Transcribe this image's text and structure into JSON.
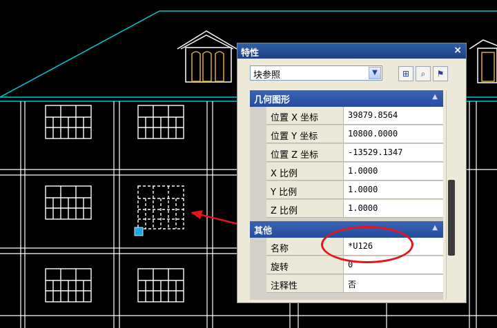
{
  "palette": {
    "title": "特性",
    "close": "×",
    "selection": "块参照",
    "category_geometry": "几何图形",
    "category_other": "其他",
    "collapse": "▲",
    "geometry_rows": [
      {
        "name": "位置 X 坐标",
        "value": "39879.8564"
      },
      {
        "name": "位置 Y 坐标",
        "value": "10800.0000"
      },
      {
        "name": "位置 Z 坐标",
        "value": "-13529.1347"
      },
      {
        "name": "X 比例",
        "value": "1.0000"
      },
      {
        "name": "Y 比例",
        "value": "1.0000"
      },
      {
        "name": "Z 比例",
        "value": "1.0000"
      }
    ],
    "other_rows": [
      {
        "name": "名称",
        "value": "*U126"
      },
      {
        "name": "旋转",
        "value": "0"
      },
      {
        "name": "注释性",
        "value": "否"
      }
    ]
  },
  "colors": {
    "roof": "#00c8d8",
    "window": "#ffffff",
    "dormer_window": "#e0b020",
    "annotation": "#e8141c",
    "grip": "#1aa8e8"
  }
}
